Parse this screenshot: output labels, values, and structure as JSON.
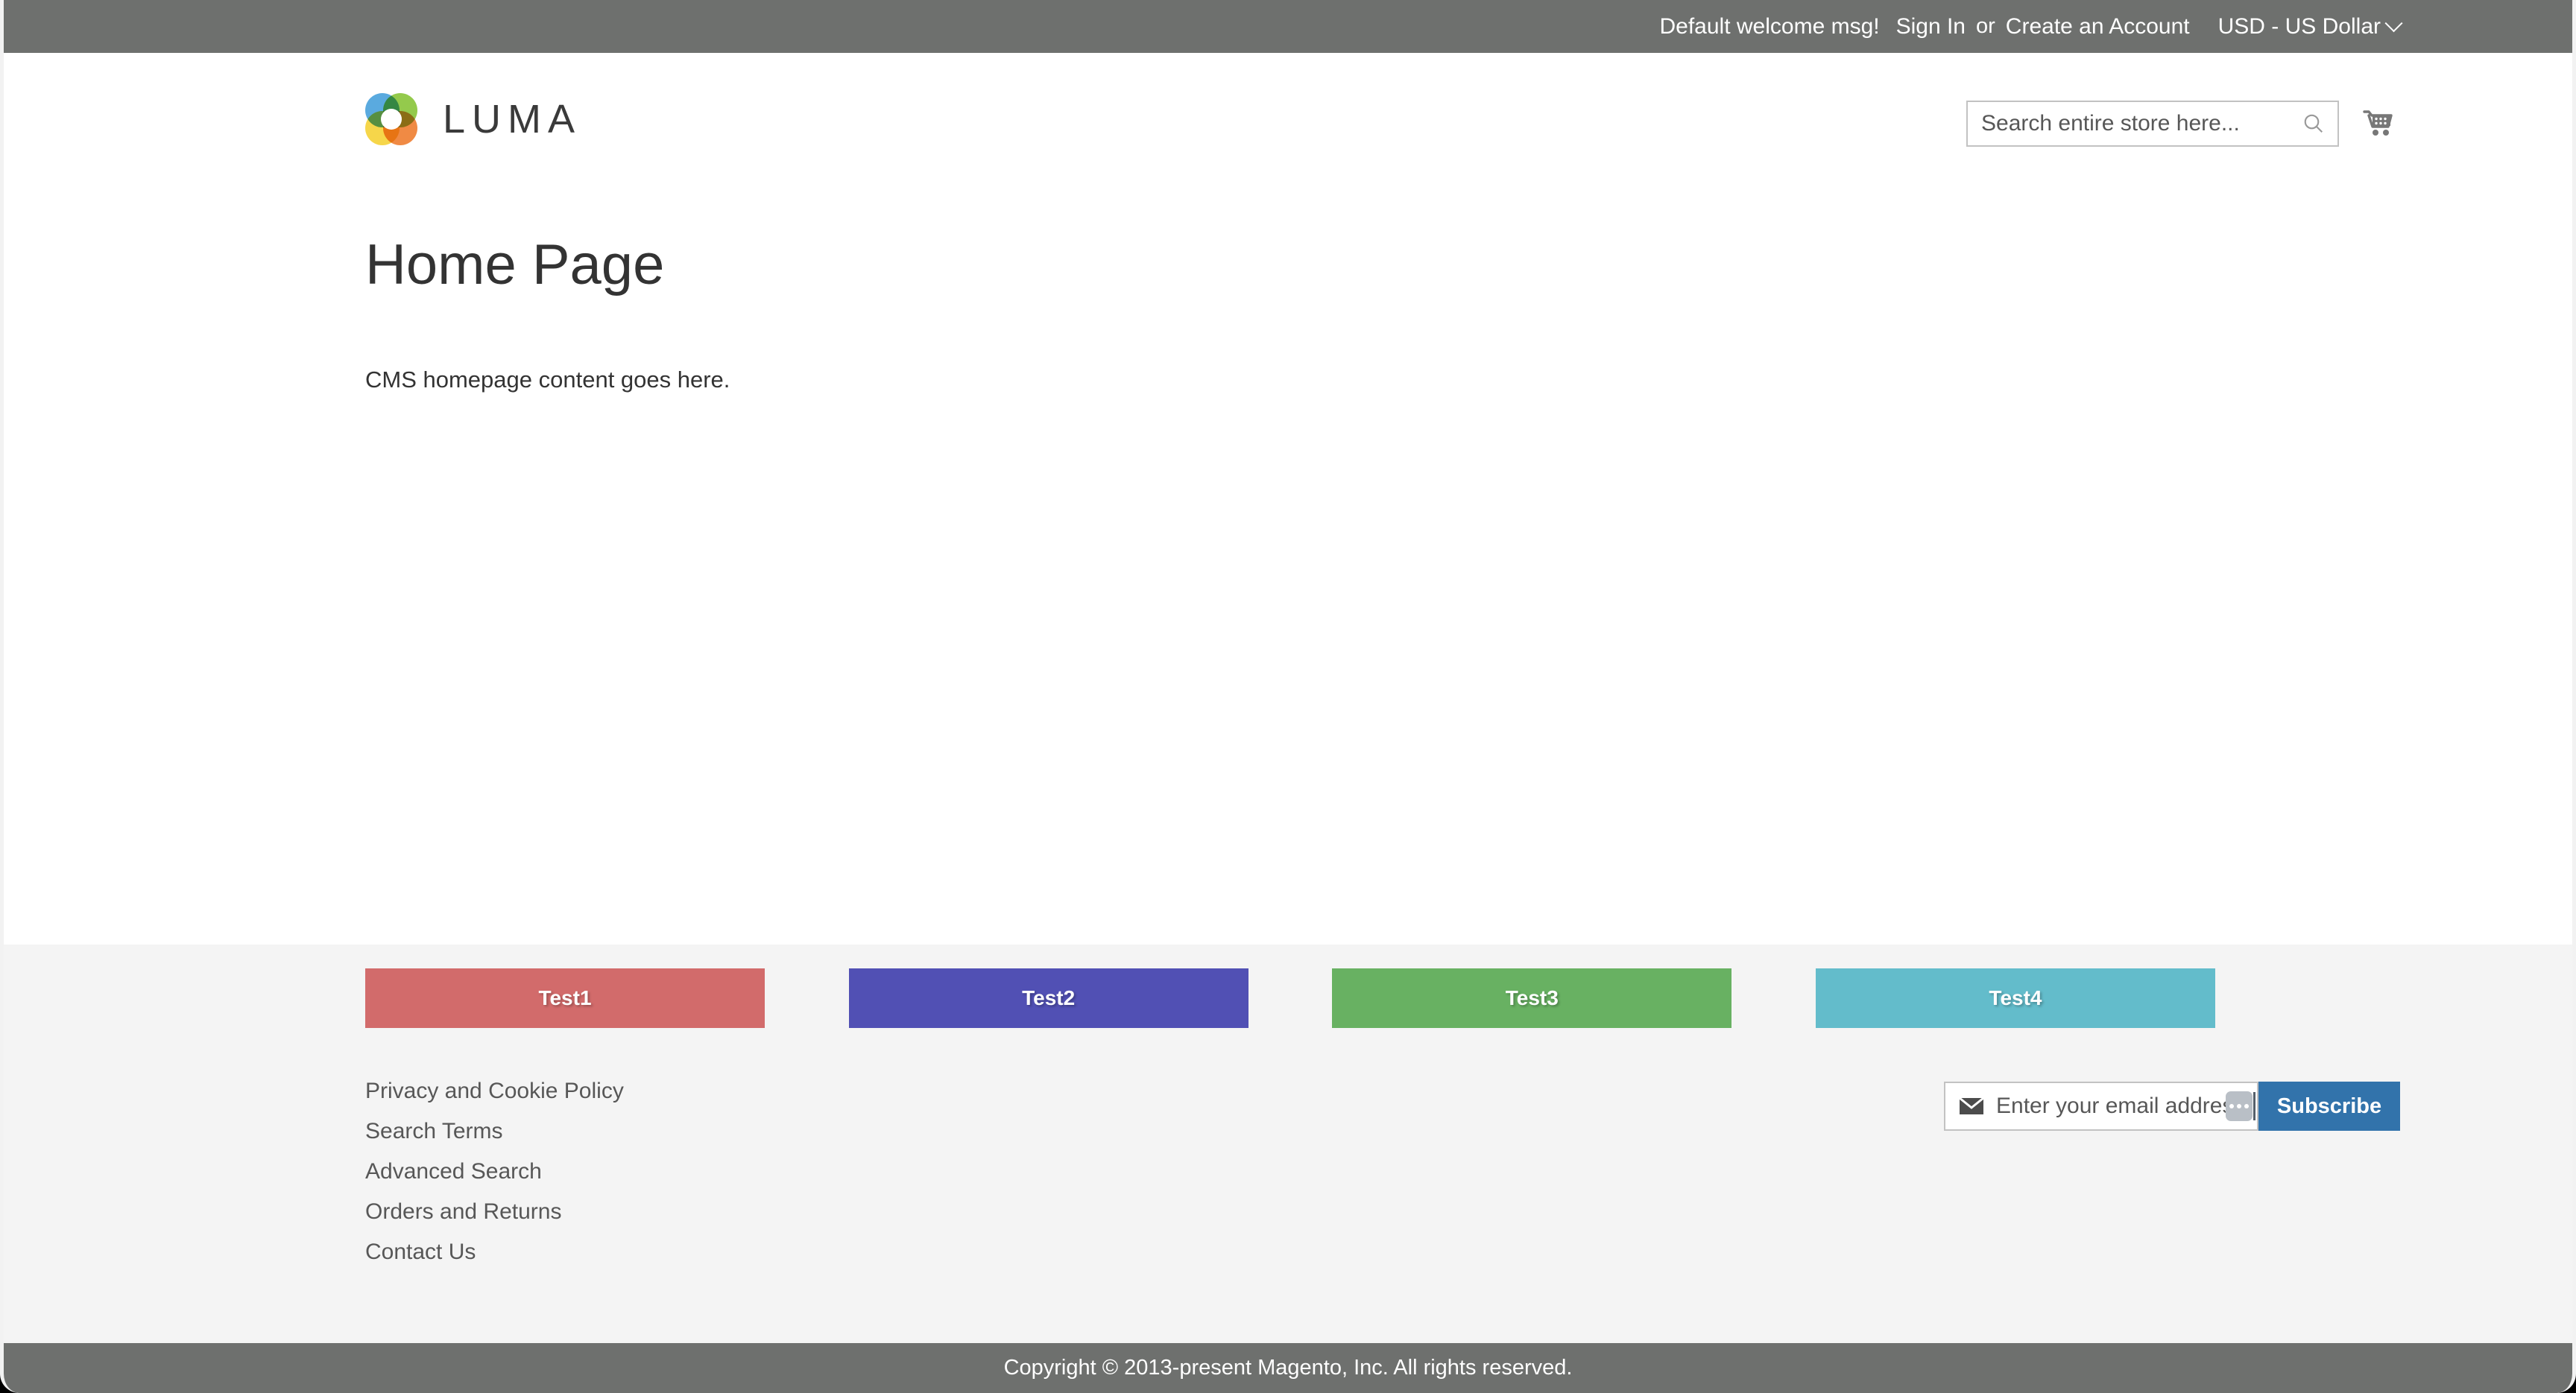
{
  "top_panel": {
    "welcome_message": "Default welcome msg!",
    "sign_in_label": "Sign In",
    "or_label": "or",
    "create_account_label": "Create an Account",
    "currency_label": "USD - US Dollar",
    "background_color": "#6e706e"
  },
  "header": {
    "logo_text": "LUMA",
    "logo_colors": {
      "blue": "#4da4dd",
      "green": "#8cc63e",
      "yellow": "#f6d33c",
      "orange": "#ef8136"
    },
    "search": {
      "placeholder": "Search entire store here...",
      "value": ""
    },
    "cart_label": "My Cart"
  },
  "main": {
    "page_title": "Home Page",
    "body_text": "CMS homepage content goes here."
  },
  "footer": {
    "background_color": "#f4f4f4",
    "promo_blocks": [
      {
        "label": "Test1",
        "color": "#d26b6b"
      },
      {
        "label": "Test2",
        "color": "#5150b4"
      },
      {
        "label": "Test3",
        "color": "#68b162"
      },
      {
        "label": "Test4",
        "color": "#63bccb"
      }
    ],
    "links": [
      {
        "label": "Privacy and Cookie Policy"
      },
      {
        "label": "Search Terms"
      },
      {
        "label": "Advanced Search"
      },
      {
        "label": "Orders and Returns"
      },
      {
        "label": "Contact Us"
      }
    ],
    "newsletter": {
      "placeholder": "Enter your email address",
      "value": "",
      "subscribe_label": "Subscribe",
      "subscribe_color": "#3273ab"
    }
  },
  "copyright": {
    "text": "Copyright © 2013-present Magento, Inc. All rights reserved."
  }
}
